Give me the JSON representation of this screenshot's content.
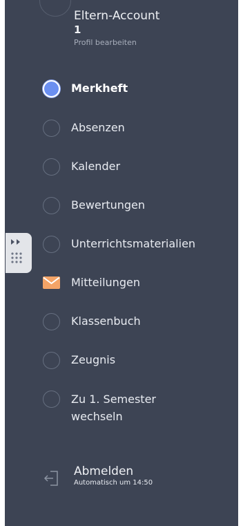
{
  "profile": {
    "name": "Eltern-Account",
    "id": "1",
    "edit_label": "Profil bearbeiten"
  },
  "nav": {
    "items": [
      {
        "label": "Merkheft",
        "state": "selected",
        "icon": "radio-selected"
      },
      {
        "label": "Absenzen",
        "state": "unselected",
        "icon": "radio"
      },
      {
        "label": "Kalender",
        "state": "unselected",
        "icon": "radio"
      },
      {
        "label": "Bewertungen",
        "state": "unselected",
        "icon": "radio"
      },
      {
        "label": "Unterrichtsmaterialien",
        "state": "unselected",
        "icon": "radio"
      },
      {
        "label": "Mitteilungen",
        "state": "unselected",
        "icon": "mail-icon"
      },
      {
        "label": "Klassenbuch",
        "state": "unselected",
        "icon": "radio"
      },
      {
        "label": "Zeugnis",
        "state": "unselected",
        "icon": "radio"
      },
      {
        "label": "Zu 1. Semester wechseln",
        "state": "unselected",
        "icon": "radio"
      }
    ]
  },
  "logout": {
    "label": "Abmelden",
    "sub": "Automatisch um 14:50",
    "icon": "logout-icon"
  },
  "handle": {
    "icons": [
      "double-chevron-right-icon",
      "dot-grid-icon"
    ]
  },
  "colors": {
    "sidebar_bg": "#3d4454",
    "selected_radio": "#6b8ff0",
    "mail_icon": "#f4a467",
    "handle_bg": "#e3e5e9"
  }
}
